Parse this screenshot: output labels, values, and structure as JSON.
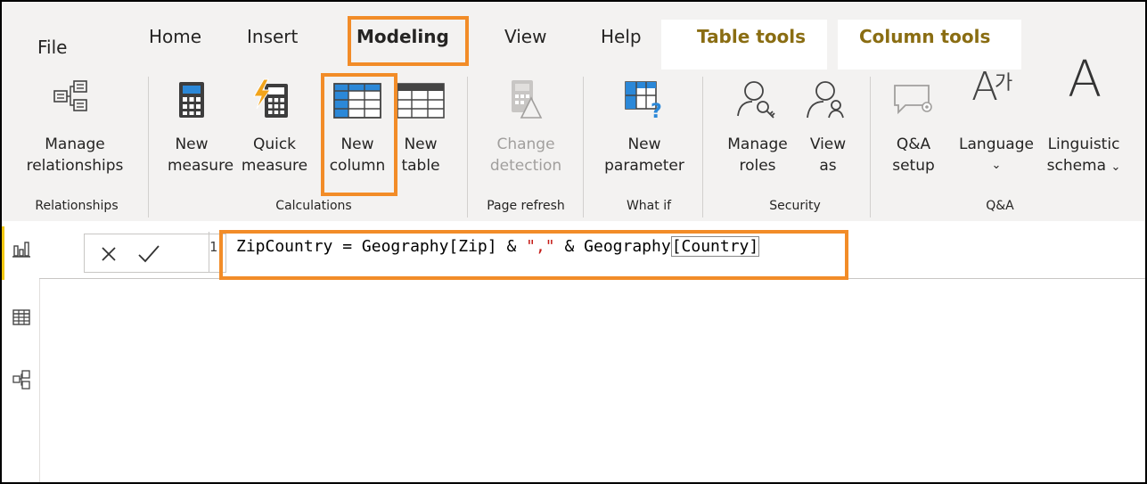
{
  "tabs": {
    "file": "File",
    "home": "Home",
    "insert": "Insert",
    "modeling": "Modeling",
    "view": "View",
    "help": "Help",
    "table_tools": "Table tools",
    "column_tools": "Column tools"
  },
  "ribbon": {
    "manage_relationships": [
      "Manage",
      "relationships"
    ],
    "new_measure": [
      "New",
      "measure"
    ],
    "quick_measure": [
      "Quick",
      "measure"
    ],
    "new_column": [
      "New",
      "column"
    ],
    "new_table": [
      "New",
      "table"
    ],
    "change_detection": [
      "Change",
      "detection"
    ],
    "new_parameter": [
      "New",
      "parameter"
    ],
    "manage_roles": [
      "Manage",
      "roles"
    ],
    "view_as": [
      "View",
      "as"
    ],
    "qa_setup": [
      "Q&A",
      "setup"
    ],
    "language": [
      "Language"
    ],
    "linguistic_schema": [
      "Linguistic",
      "schema"
    ]
  },
  "groups": {
    "relationships": "Relationships",
    "calculations": "Calculations",
    "page_refresh": "Page refresh",
    "what_if": "What if",
    "security": "Security",
    "qa": "Q&A"
  },
  "formula": {
    "line_number": "1",
    "name": "ZipCountry",
    "eq": " = ",
    "part1": "Geography[Zip]",
    "amp1": " & ",
    "sep_string": "\",\"",
    "amp2": " & ",
    "part2_table": "Geography",
    "part2_col": "[Country]"
  },
  "icons": {
    "language_glyph": "가",
    "schema_glyph": "A"
  },
  "colors": {
    "highlight": "#f28c28",
    "context_tab": "#8a6d12",
    "nav_selected": "#f2c811"
  }
}
